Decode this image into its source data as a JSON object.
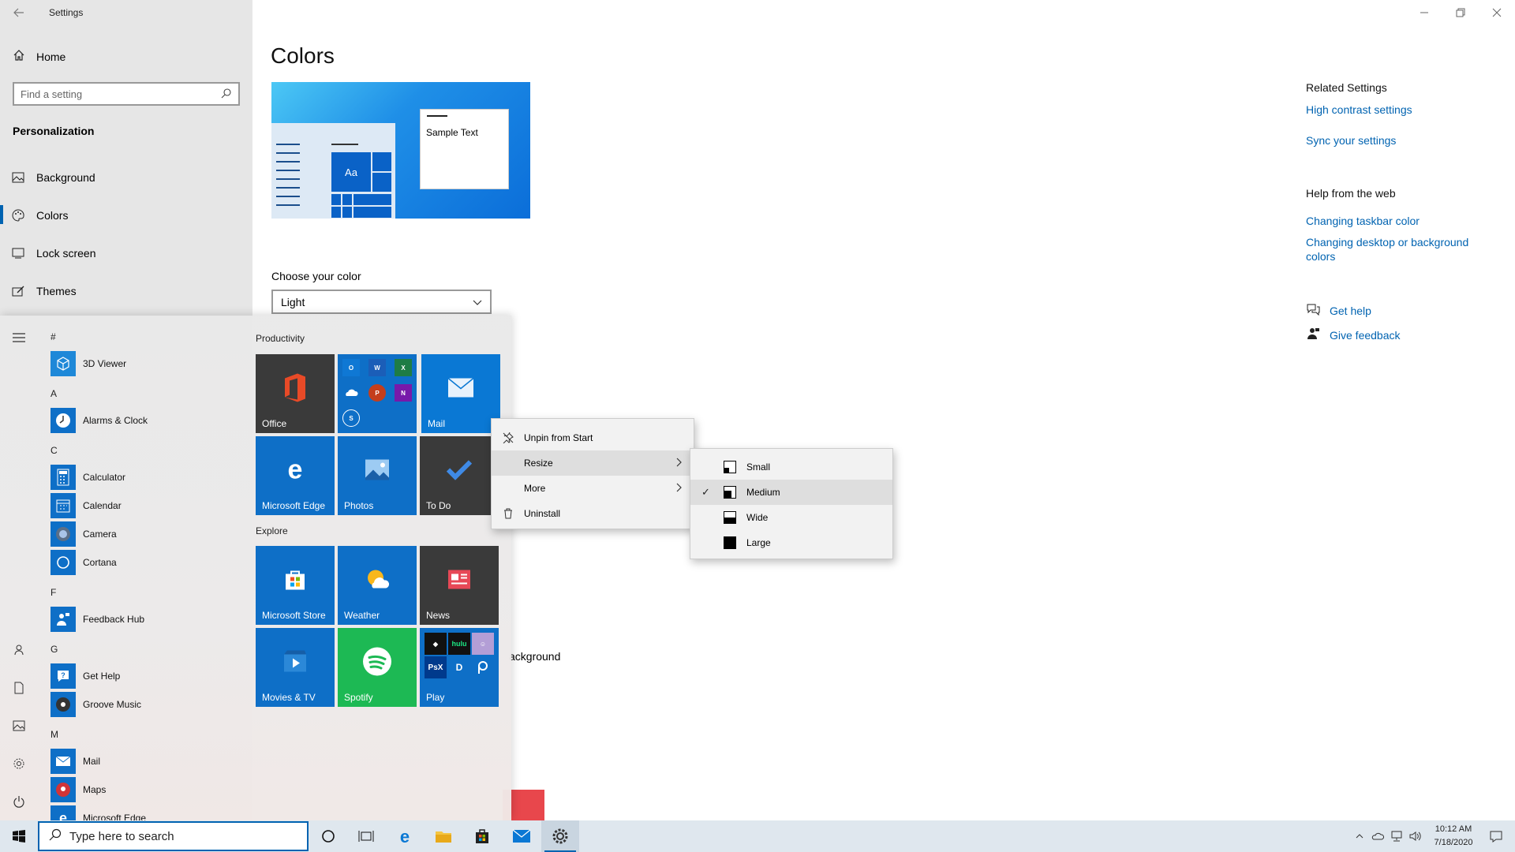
{
  "window": {
    "title": "Settings"
  },
  "nav": {
    "home": "Home",
    "search_placeholder": "Find a setting",
    "group": "Personalization",
    "items": [
      {
        "label": "Background"
      },
      {
        "label": "Colors"
      },
      {
        "label": "Lock screen"
      },
      {
        "label": "Themes"
      }
    ]
  },
  "main": {
    "title": "Colors",
    "preview_sample_text": "Sample Text",
    "preview_tile_text": "Aa",
    "choose_color_label": "Choose your color",
    "choose_color_value": "Light",
    "partial_text": "ackground"
  },
  "related": {
    "heading": "Related Settings",
    "links": [
      "High contrast settings",
      "Sync your settings"
    ],
    "web_heading": "Help from the web",
    "web_links": [
      "Changing taskbar color",
      "Changing desktop or background colors"
    ],
    "get_help": "Get help",
    "give_feedback": "Give feedback"
  },
  "start": {
    "letters": [
      "#",
      "A",
      "C",
      "F",
      "G",
      "M"
    ],
    "apps": [
      {
        "label": "3D Viewer",
        "color": "#1e88d8"
      },
      {
        "label": "Alarms & Clock",
        "color": "#0e6fc7"
      },
      {
        "label": "Calculator",
        "color": "#0e6fc7"
      },
      {
        "label": "Calendar",
        "color": "#0e6fc7"
      },
      {
        "label": "Camera",
        "color": "#0e6fc7"
      },
      {
        "label": "Cortana",
        "color": "#0e6fc7"
      },
      {
        "label": "Feedback Hub",
        "color": "#0e6fc7"
      },
      {
        "label": "Get Help",
        "color": "#0e6fc7"
      },
      {
        "label": "Groove Music",
        "color": "#0e6fc7"
      },
      {
        "label": "Mail",
        "color": "#0e6fc7"
      },
      {
        "label": "Maps",
        "color": "#0e6fc7"
      },
      {
        "label": "Microsoft Edge",
        "color": "#0e6fc7"
      }
    ],
    "groups": [
      "Productivity",
      "Explore"
    ],
    "tiles": [
      {
        "label": "Office",
        "color": "#3a3a3a"
      },
      {
        "label": "",
        "color": "#0e6fc7"
      },
      {
        "label": "Mail",
        "color": "#0a78d4"
      },
      {
        "label": "Microsoft Edge",
        "color": "#0e6fc7"
      },
      {
        "label": "Photos",
        "color": "#0e6fc7"
      },
      {
        "label": "To Do",
        "color": "#3a3a3a"
      },
      {
        "label": "Microsoft Store",
        "color": "#0e6fc7"
      },
      {
        "label": "Weather",
        "color": "#0e6fc7"
      },
      {
        "label": "News",
        "color": "#3a3a3a"
      },
      {
        "label": "Movies & TV",
        "color": "#0e6fc7"
      },
      {
        "label": "Spotify",
        "color": "#1db954"
      },
      {
        "label": "Play",
        "color": "#0e6fc7"
      }
    ],
    "mini_labels": {
      "hulu": "hulu",
      "psx": "PsX"
    }
  },
  "context_menu": {
    "items": [
      "Unpin from Start",
      "Resize",
      "More",
      "Uninstall"
    ],
    "highlighted": "Resize"
  },
  "resize_menu": {
    "items": [
      "Small",
      "Medium",
      "Wide",
      "Large"
    ],
    "checked": "Medium"
  },
  "taskbar": {
    "search_placeholder": "Type here to search",
    "time": "10:12 AM",
    "date": "7/18/2020"
  },
  "colors": {
    "accent": "#0063b1",
    "link": "#0063b1",
    "red_swatch": "#e8474c"
  }
}
